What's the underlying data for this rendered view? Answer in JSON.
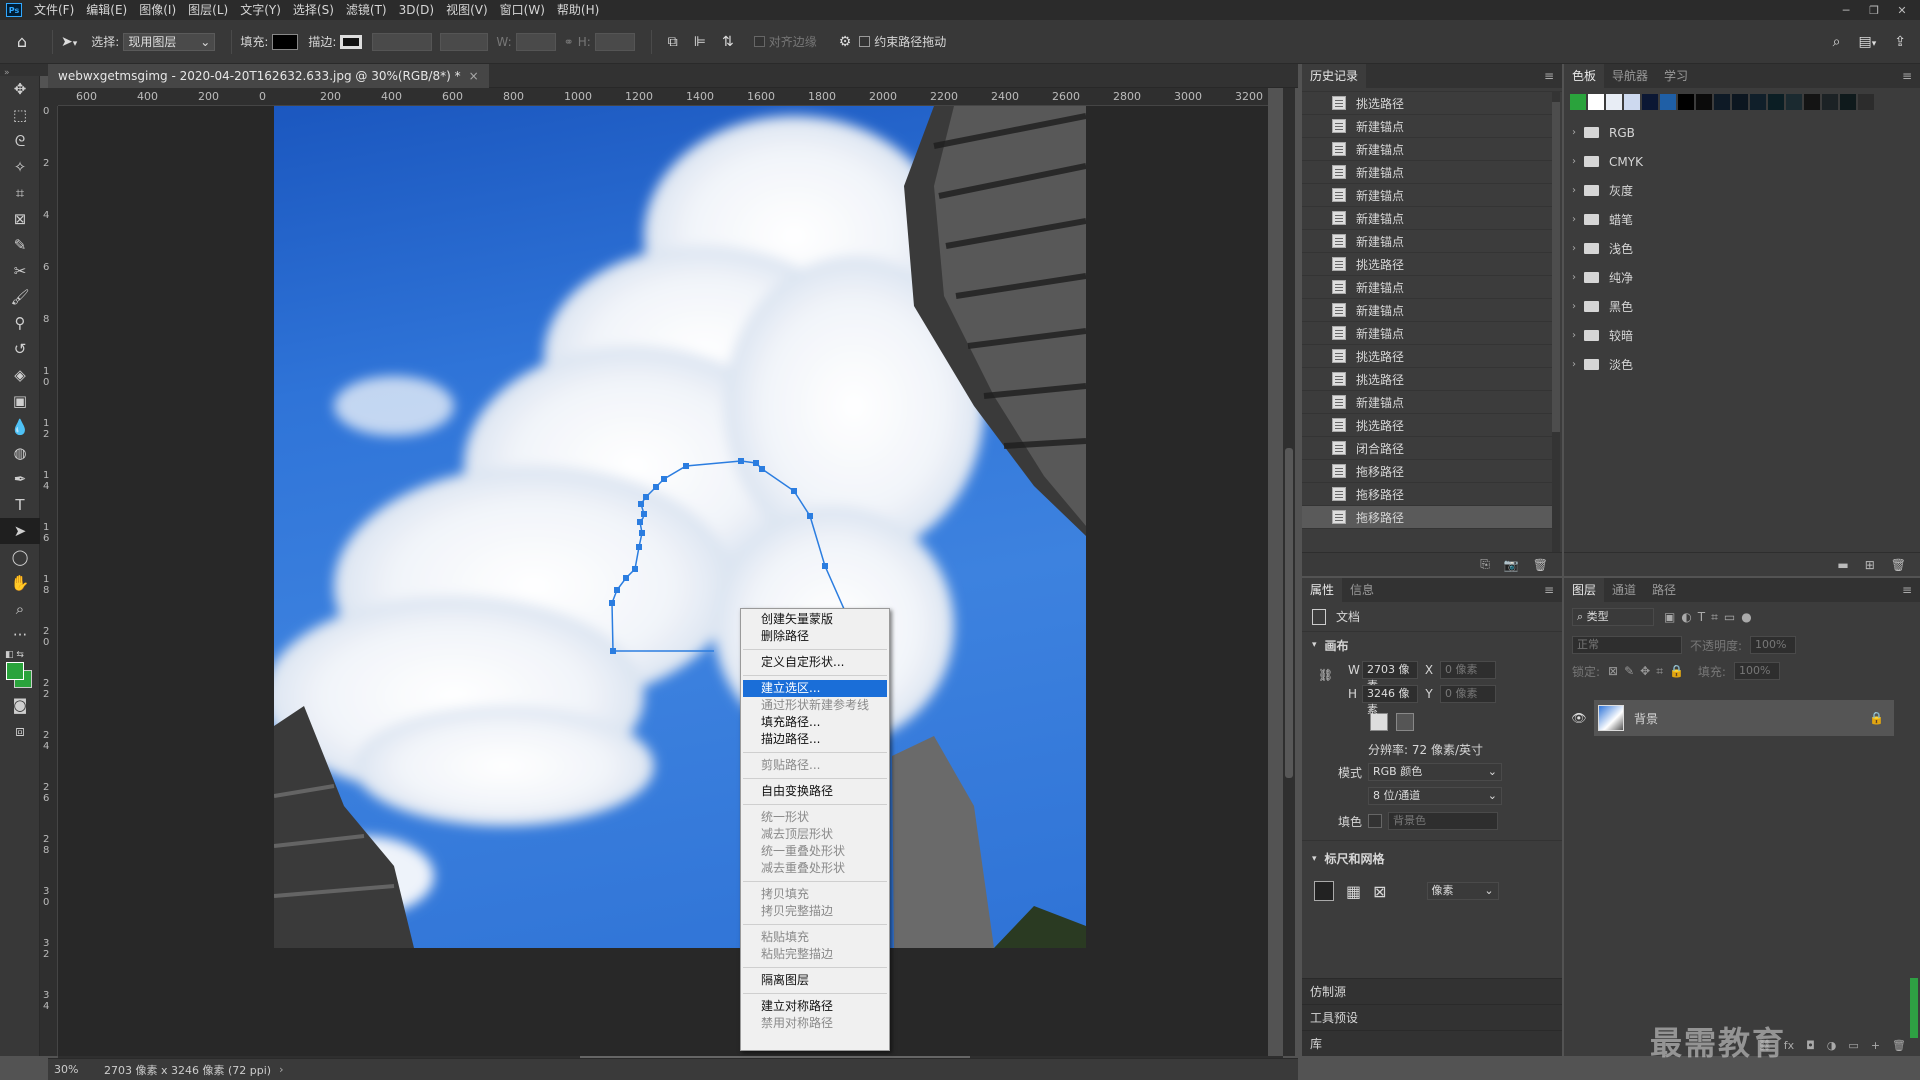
{
  "menubar": {
    "logo": "Ps",
    "items": [
      "文件(F)",
      "编辑(E)",
      "图像(I)",
      "图层(L)",
      "文字(Y)",
      "选择(S)",
      "滤镜(T)",
      "3D(D)",
      "视图(V)",
      "窗口(W)",
      "帮助(H)"
    ],
    "window_controls": [
      "─",
      "❐",
      "✕"
    ]
  },
  "options": {
    "select_label": "选择:",
    "select_value": "现用图层",
    "fill_label": "填充:",
    "stroke_label": "描边:",
    "w_label": "W:",
    "h_label": "H:",
    "align_edges": "对齐边缘",
    "constrain": "约束路径拖动"
  },
  "document": {
    "tab_title": "webwxgetmsgimg - 2020-04-20T162632.633.jpg @ 30%(RGB/8*) *",
    "close": "×"
  },
  "rulers": {
    "h_ticks": [
      "600",
      "400",
      "200",
      "0",
      "200",
      "400",
      "600",
      "800",
      "1000",
      "1200",
      "1400",
      "1600",
      "1800",
      "2000",
      "2200",
      "2400",
      "2600",
      "2800",
      "3000",
      "3200"
    ],
    "v_ticks": [
      "0",
      "2",
      "4",
      "6",
      "8",
      "1\n0",
      "1\n2",
      "1\n4",
      "1\n6",
      "1\n8",
      "2\n0",
      "2\n2",
      "2\n4",
      "2\n6",
      "2\n8",
      "3\n0",
      "3\n2",
      "3\n4"
    ]
  },
  "status": {
    "zoom": "30%",
    "info": "2703 像素 x 3246 像素 (72 ppi)",
    "arrow": "›"
  },
  "context_menu": [
    {
      "label": "创建矢量蒙版",
      "state": "normal"
    },
    {
      "label": "删除路径",
      "state": "normal"
    },
    {
      "sep": true
    },
    {
      "label": "定义自定形状...",
      "state": "normal"
    },
    {
      "sep": true
    },
    {
      "label": "建立选区...",
      "state": "highlight"
    },
    {
      "label": "通过形状新建参考线",
      "state": "disabled"
    },
    {
      "label": "填充路径...",
      "state": "normal"
    },
    {
      "label": "描边路径...",
      "state": "normal"
    },
    {
      "sep": true
    },
    {
      "label": "剪贴路径...",
      "state": "disabled"
    },
    {
      "sep": true
    },
    {
      "label": "自由变换路径",
      "state": "normal"
    },
    {
      "sep": true
    },
    {
      "label": "统一形状",
      "state": "disabled"
    },
    {
      "label": "减去顶层形状",
      "state": "disabled"
    },
    {
      "label": "统一重叠处形状",
      "state": "disabled"
    },
    {
      "label": "减去重叠处形状",
      "state": "disabled"
    },
    {
      "sep": true
    },
    {
      "label": "拷贝填充",
      "state": "disabled"
    },
    {
      "label": "拷贝完整描边",
      "state": "disabled"
    },
    {
      "sep": true
    },
    {
      "label": "粘贴填充",
      "state": "disabled"
    },
    {
      "label": "粘贴完整描边",
      "state": "disabled"
    },
    {
      "sep": true
    },
    {
      "label": "隔离图层",
      "state": "normal"
    },
    {
      "sep": true
    },
    {
      "label": "建立对称路径",
      "state": "normal"
    },
    {
      "label": "禁用对称路径",
      "state": "disabled"
    }
  ],
  "history": {
    "tab": "历史记录",
    "items": [
      "挑选路径",
      "新建锚点",
      "新建锚点",
      "新建锚点",
      "新建锚点",
      "新建锚点",
      "新建锚点",
      "挑选路径",
      "新建锚点",
      "新建锚点",
      "新建锚点",
      "挑选路径",
      "挑选路径",
      "新建锚点",
      "挑选路径",
      "闭合路径",
      "拖移路径",
      "拖移路径",
      "拖移路径"
    ],
    "selected_index": 18,
    "menu": "≡"
  },
  "swatches": {
    "tabs": [
      "色板",
      "导航器",
      "学习"
    ],
    "colors": [
      "#2aa33c",
      "#ffffff",
      "#e8edf5",
      "#cdd9ef",
      "#0b1734",
      "#1f5fa6",
      "#000000",
      "#0b0b0b",
      "#0e1a26",
      "#0c1620",
      "#101f2a",
      "#0b1e24",
      "#1b2a30",
      "#141414",
      "#1c2225",
      "#0f1a1c",
      "#2c2c2c"
    ],
    "folders": [
      "RGB",
      "CMYK",
      "灰度",
      "蜡笔",
      "浅色",
      "纯净",
      "黑色",
      "较暗",
      "淡色"
    ]
  },
  "properties": {
    "tabs": [
      "属性",
      "信息"
    ],
    "doc_label": "文档",
    "canvas_section": "画布",
    "w_label": "W",
    "w_value": "2703 像素",
    "x_label": "X",
    "x_value": "0 像素",
    "h_label": "H",
    "h_value": "3246 像素",
    "y_label": "Y",
    "y_value": "0 像素",
    "resolution": "分辨率: 72 像素/英寸",
    "mode_label": "模式",
    "mode_value": "RGB 颜色",
    "depth_value": "8 位/通道",
    "fill_label": "填色",
    "fill_value": "背景色",
    "rulers_section": "标尺和网格",
    "unit_value": "像素"
  },
  "stack": [
    "仿制源",
    "工具预设",
    "库"
  ],
  "layers": {
    "tabs": [
      "图层",
      "通道",
      "路径"
    ],
    "search_placeholder": "类型",
    "blend": "正常",
    "opacity_label": "不透明度:",
    "opacity_value": "100%",
    "lock_label": "锁定:",
    "fill_label": "填充:",
    "fill_value": "100%",
    "layer_name": "背景",
    "foot": [
      "⛓",
      "fx",
      "◘",
      "◑",
      "▭",
      "+",
      "🗑"
    ]
  },
  "watermark": "最需教育"
}
